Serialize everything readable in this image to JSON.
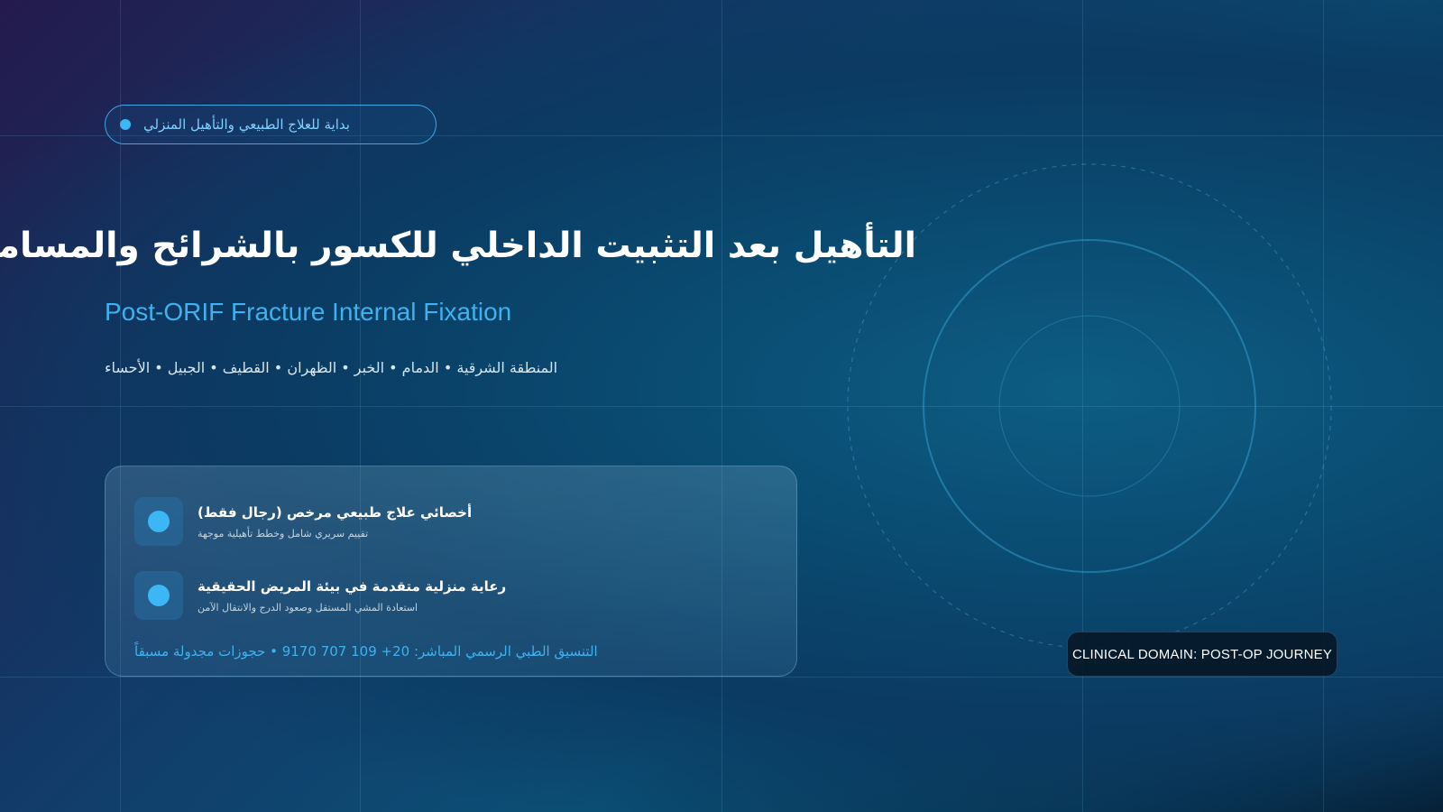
{
  "colors": {
    "accent": "#3cb6f4",
    "subtitle": "#3fb2ee",
    "background_dark": "#04192a",
    "background_purple": "#241a4d"
  },
  "badge": {
    "text": "بداية للعلاج الطبيعي والتأهيل المنزلي",
    "icon": "dot-icon"
  },
  "hero": {
    "title_ar": "التأهيل بعد التثبيت الداخلي للكسور بالشرائح والمسامير",
    "title_en": "Post-ORIF Fracture Internal Fixation",
    "cities": "المنطقة الشرقية • الدمام • الخبر • الظهران • القطيف • الجبيل • الأحساء"
  },
  "card": {
    "features": [
      {
        "icon": "dot-icon",
        "title": "أخصائي علاج طبيعي مرخص (رجال فقط)",
        "subtitle": "تقييم سريري شامل وخطط تأهيلية موجهة"
      },
      {
        "icon": "dot-icon",
        "title": "رعاية منزلية متقدمة في بيئة المريض الحقيقية",
        "subtitle": "استعادة المشي المستقل وصعود الدرج والانتقال الآمن"
      }
    ],
    "contact": "التنسيق الطبي الرسمي المباشر: 20+ 109 707 9170 • حجوزات مجدولة مسبقاً"
  },
  "domain_badge": {
    "text": "CLINICAL DOMAIN: POST-OP JOURNEY"
  }
}
